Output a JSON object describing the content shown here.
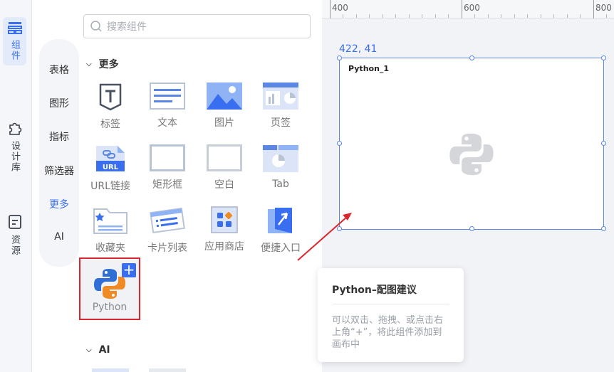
{
  "rail": {
    "components_label": "组件",
    "library_label": "设计库",
    "resources_label": "资源"
  },
  "categories": [
    "表格",
    "图形",
    "指标",
    "筛选器",
    "更多",
    "AI"
  ],
  "search": {
    "placeholder": "搜索组件"
  },
  "sections": {
    "more": "更多",
    "ai": "AI"
  },
  "tiles": {
    "label": "标签",
    "text": "文本",
    "image": "图片",
    "page_tab": "页签",
    "url_link": "URL链接",
    "rect": "矩形框",
    "blank": "空白",
    "tab": "Tab",
    "favorites": "收藏夹",
    "card_list": "卡片列表",
    "app_store": "应用商店",
    "quick_entry": "便捷入口",
    "python": "Python"
  },
  "canvas": {
    "ruler_labels": [
      "400",
      "600",
      "800"
    ],
    "coord": "422, 41",
    "widget_title": "Python_1"
  },
  "tooltip": {
    "title": "Python–配图建议",
    "body": "可以双击、拖拽、或点击右上角“+”，将此组件添加到画布中"
  },
  "colors": {
    "accent": "#3a6ef0",
    "highlight": "#d9262f"
  }
}
